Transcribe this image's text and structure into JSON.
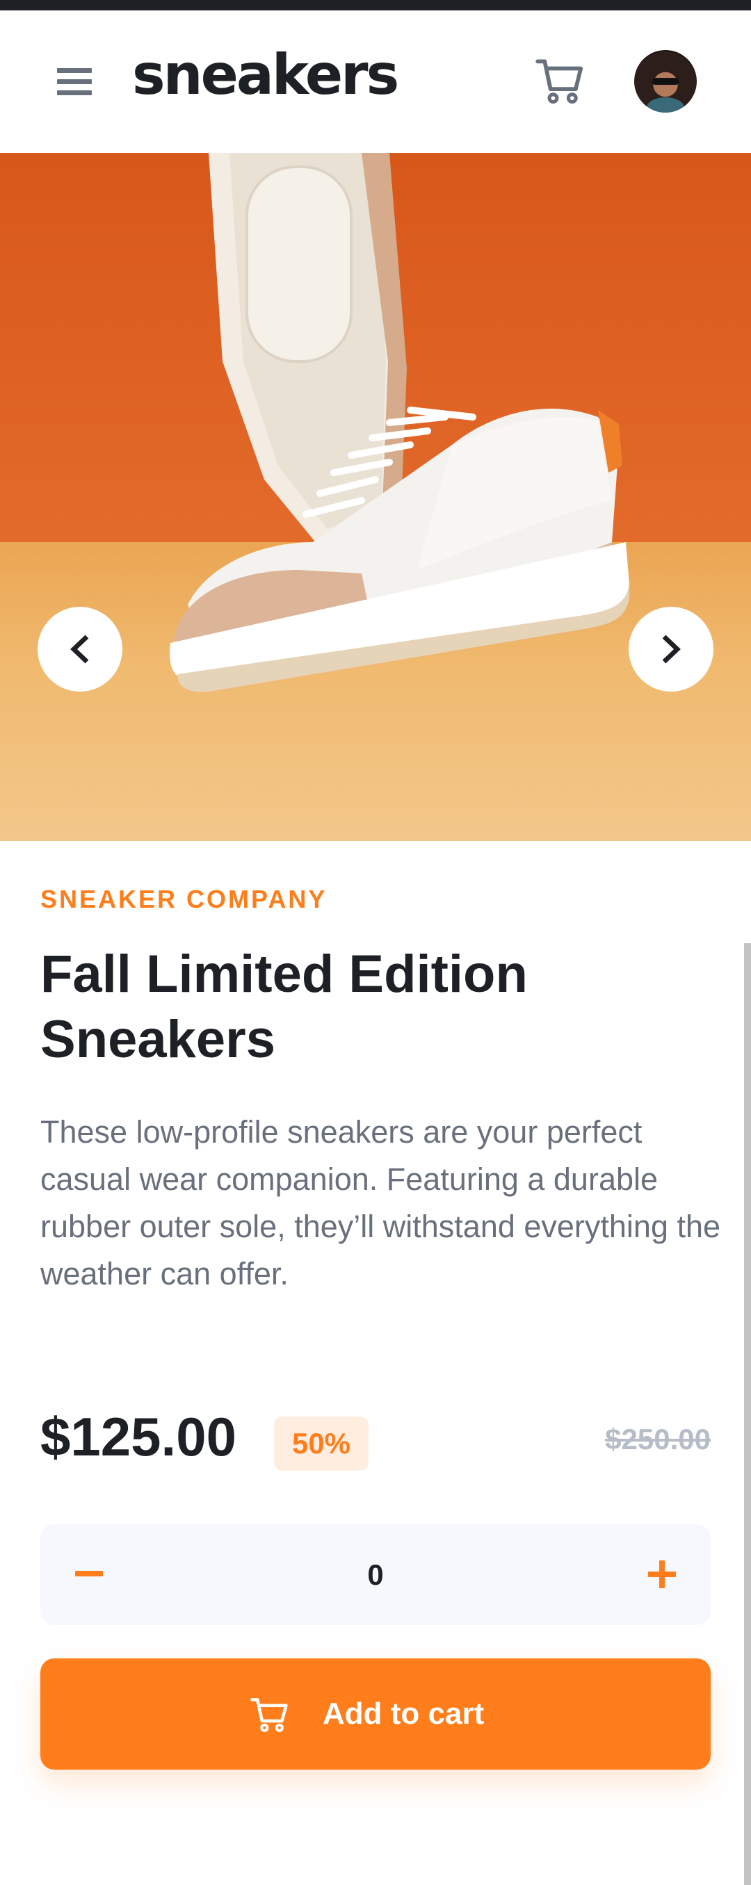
{
  "header": {
    "logo": "sneakers",
    "menu_icon": "hamburger-menu-icon",
    "cart_icon": "cart-icon",
    "avatar": "user-avatar"
  },
  "gallery": {
    "prev_icon": "chevron-left-icon",
    "next_icon": "chevron-right-icon"
  },
  "product": {
    "company": "SNEAKER COMPANY",
    "title": "Fall Limited Edition Sneakers",
    "description": "These low-profile sneakers are your perfect casual wear companion. Featuring a durable rubber outer sole, they’ll withstand everything the weather can offer.",
    "price": "$125.00",
    "discount": "50%",
    "original_price": "$250.00"
  },
  "quantity": {
    "minus_label": "−",
    "value": "0",
    "plus_label": "+"
  },
  "actions": {
    "add_to_cart": "Add to cart"
  },
  "colors": {
    "accent": "#ff7e1b",
    "accent_pale": "#ffede0",
    "dark": "#1d2025",
    "grey_text": "#69707d",
    "light_grey": "#b6bcc8",
    "qty_bg": "#f6f8fd"
  }
}
